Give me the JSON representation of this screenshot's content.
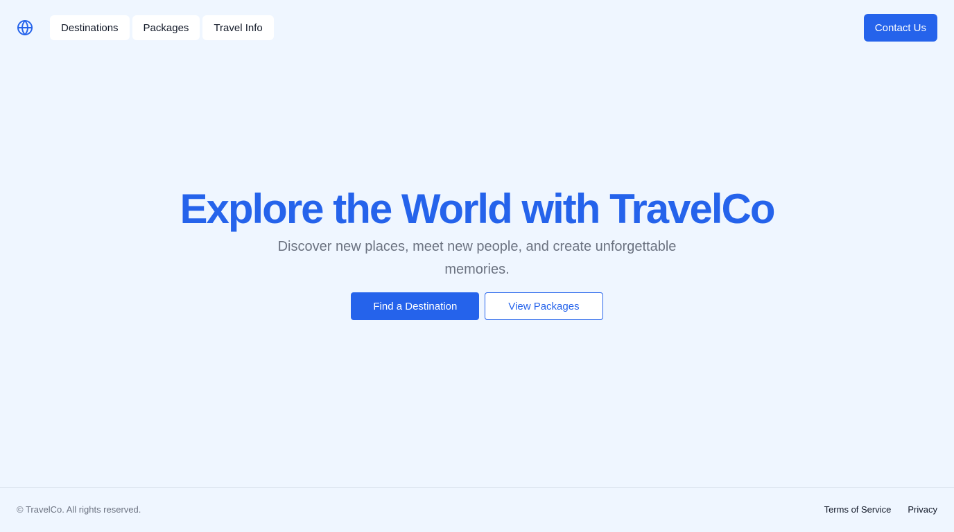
{
  "header": {
    "logo_icon": "globe-icon",
    "nav": {
      "destinations": "Destinations",
      "packages": "Packages",
      "travel_info": "Travel Info"
    },
    "contact_label": "Contact Us"
  },
  "hero": {
    "title": "Explore the World with TravelCo",
    "subtitle": "Discover new places, meet new people, and create unforgettable memories.",
    "primary_cta": "Find a Destination",
    "secondary_cta": "View Packages"
  },
  "footer": {
    "copyright": "© TravelCo. All rights reserved.",
    "links": {
      "terms": "Terms of Service",
      "privacy": "Privacy"
    }
  },
  "colors": {
    "accent": "#2563eb",
    "background": "#eff6ff",
    "muted_text": "#6b7280"
  }
}
